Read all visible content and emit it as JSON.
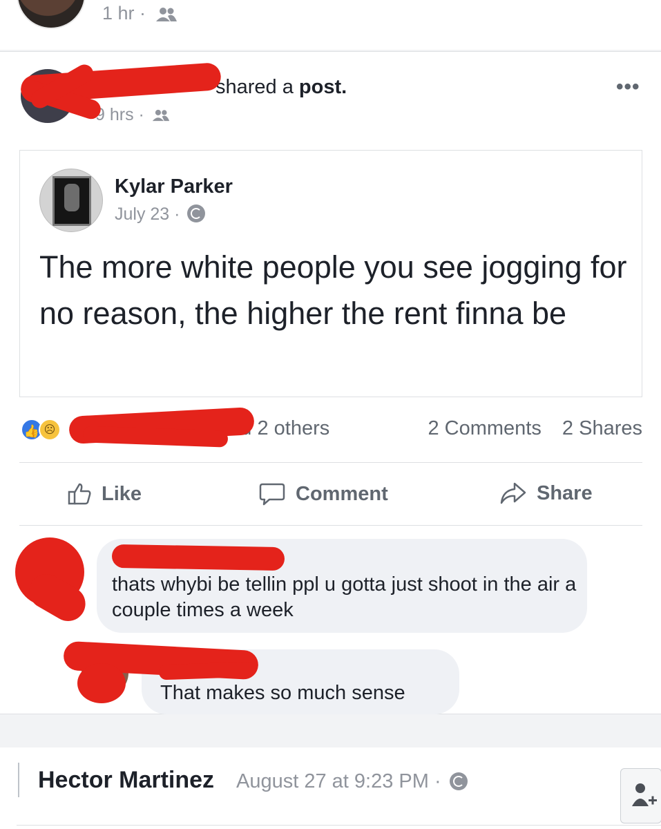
{
  "previous_post": {
    "time": "1 hr ·",
    "audience_icon": "friends-icon"
  },
  "share_header": {
    "action_prefix": "shared a ",
    "action_object": "post.",
    "time": "9 hrs ·",
    "audience_icon": "friends-icon",
    "more_icon": "more-dots-icon",
    "more_glyph": "•••"
  },
  "original_post": {
    "author": "Kylar Parker",
    "date": "July 23 ·",
    "privacy_icon": "globe-icon",
    "text": "The more white people you see jogging for no reason, the higher the rent finna be"
  },
  "reactions": {
    "icons": [
      "like-reaction-icon",
      "sad-reaction-icon"
    ],
    "summary": "and 2 others",
    "comments_count": "2 Comments",
    "shares_count": "2 Shares"
  },
  "actions": {
    "like": "Like",
    "comment": "Comment",
    "share": "Share"
  },
  "comments": [
    {
      "text": "thats whybi be tellin ppl u gotta just shoot in the air a couple times a week"
    },
    {
      "text": "That makes so much sense"
    }
  ],
  "next_post": {
    "author": "Hector Martinez",
    "date": "August 27 at 9:23 PM ·",
    "privacy_icon": "globe-icon"
  },
  "colors": {
    "redaction": "#e4231b",
    "like_blue": "#3578e5",
    "text_dark": "#1d2129",
    "text_muted": "#90949c"
  }
}
